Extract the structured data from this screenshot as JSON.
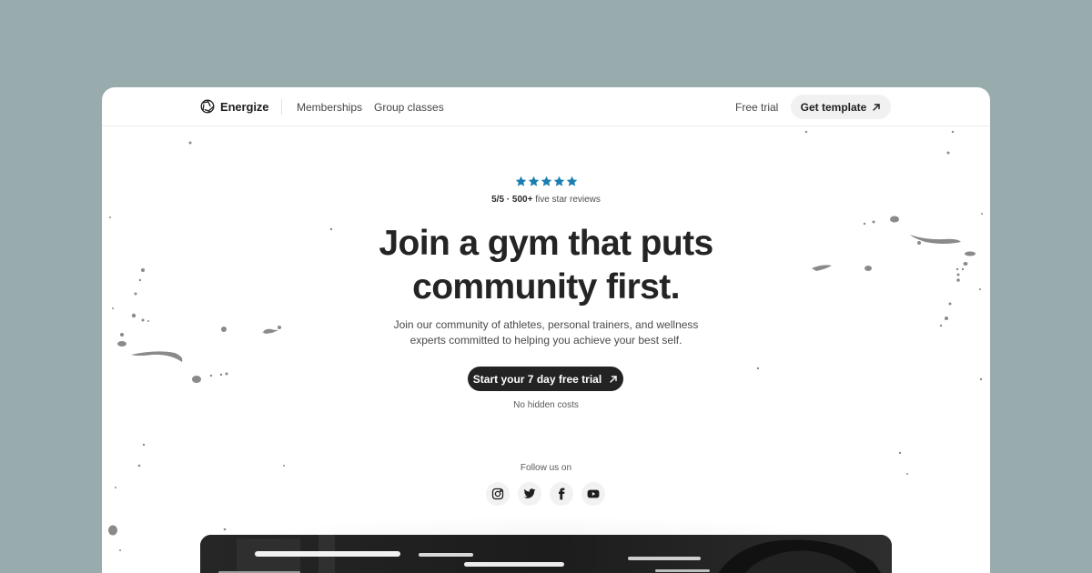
{
  "brand": {
    "name": "Energize",
    "icon": "aperture-icon"
  },
  "nav": {
    "links": [
      "Memberships",
      "Group classes"
    ],
    "free_trial": "Free trial",
    "get_template": "Get template"
  },
  "hero": {
    "stars": 5,
    "star_color": "#1a7fb0",
    "rating_strong": "5/5 · 500+",
    "rating_rest": " five star reviews",
    "headline_line1": "Join a gym that puts",
    "headline_line2": "community first.",
    "sub_line1": "Join our community of athletes, personal trainers, and wellness",
    "sub_line2": "experts committed to helping you achieve your best self.",
    "cta_label": "Start your 7 day free trial",
    "cta_note": "No hidden costs"
  },
  "social": {
    "label": "Follow us on",
    "icons": [
      "instagram-icon",
      "twitter-icon",
      "facebook-icon",
      "youtube-icon"
    ]
  },
  "colors": {
    "page_bg": "#98abad",
    "card_bg": "#ffffff",
    "cta_bg": "#232323",
    "pill_bg": "#f1f1f1"
  }
}
